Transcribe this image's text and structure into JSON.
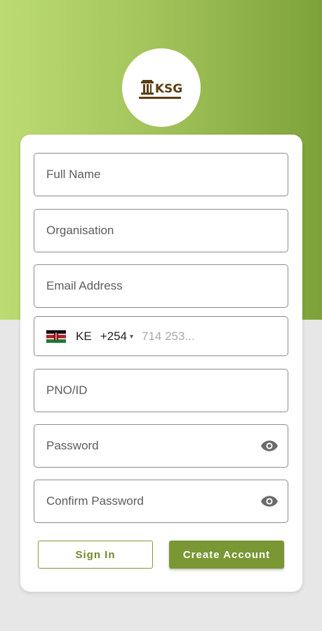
{
  "brand": {
    "logo_text": "KSG",
    "colors": {
      "header_light": "#bcdc73",
      "header_dark": "#7ea23a",
      "primary": "#799733"
    }
  },
  "form": {
    "full_name": {
      "placeholder": "Full Name",
      "value": ""
    },
    "organisation": {
      "placeholder": "Organisation",
      "value": ""
    },
    "email": {
      "placeholder": "Email Address",
      "value": ""
    },
    "phone": {
      "country_code": "KE",
      "dial_code": "+254",
      "flag_icon": "kenya-flag-icon",
      "placeholder": "714 253...",
      "value": ""
    },
    "pno": {
      "placeholder": "PNO/ID",
      "value": ""
    },
    "password": {
      "placeholder": "Password",
      "value": "",
      "toggle_icon": "eye-icon"
    },
    "confirm_password": {
      "placeholder": "Confirm Password",
      "value": "",
      "toggle_icon": "eye-icon"
    }
  },
  "actions": {
    "sign_in_label": "Sign In",
    "create_account_label": "Create Account"
  }
}
